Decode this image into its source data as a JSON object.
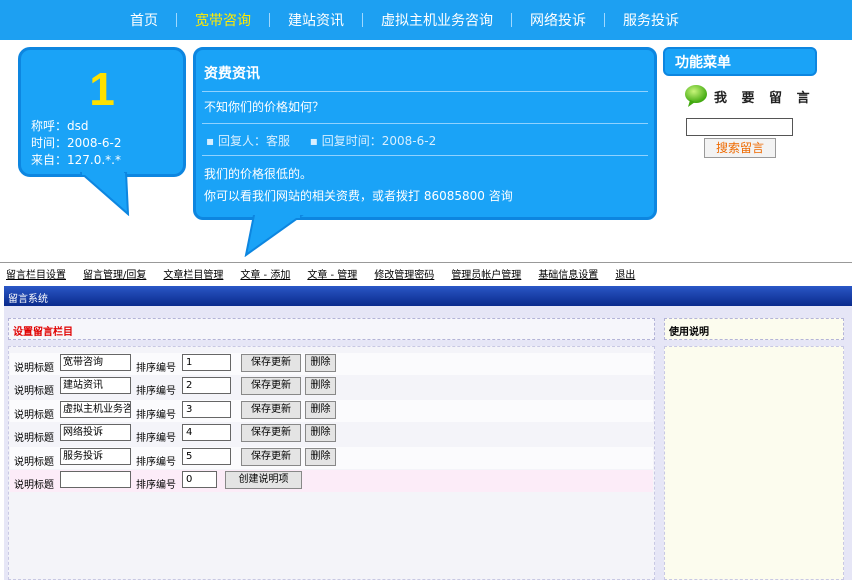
{
  "nav": {
    "items": [
      {
        "label": "首页",
        "active": false
      },
      {
        "label": "宽带咨询",
        "active": true
      },
      {
        "label": "建站资讯",
        "active": false
      },
      {
        "label": "虚拟主机业务咨询",
        "active": false
      },
      {
        "label": "网络投诉",
        "active": false
      },
      {
        "label": "服务投诉",
        "active": false
      }
    ]
  },
  "bubble1": {
    "number": "1",
    "name_line": "称呼：dsd",
    "time_line": "时间：2008-6-2",
    "from_line": "来自：127.0.*.*"
  },
  "bubble2": {
    "title": "资费资讯",
    "question": "不知你们的价格如何？",
    "replier": "▪ 回复人：客服",
    "reply_time": "▪ 回复时间：2008-6-2",
    "answer1": "我们的价格很低的。",
    "answer2": "你可以看我们网站的相关资费，或者拨打 86085800 咨询"
  },
  "func_menu": {
    "title": "功能菜单",
    "message_title": "我 要 留 言",
    "search_value": "",
    "search_button": "搜索留言"
  },
  "admin_nav": {
    "items": [
      "留言栏目设置",
      "留言管理/回复",
      "文章栏目管理",
      "文章 - 添加",
      "文章 - 管理",
      "修改管理密码",
      "管理员帐户管理",
      "基础信息设置",
      "退出"
    ]
  },
  "system_title": "留言系统",
  "panel": {
    "left_title": "设置留言栏目",
    "right_title": "使用说明",
    "label_title": "说明标题",
    "label_order": "排序编号",
    "save_label": "保存更新",
    "delete_label": "删除",
    "create_label": "创建说明项",
    "rows": [
      {
        "title": "宽带咨询",
        "order": "1"
      },
      {
        "title": "建站资讯",
        "order": "2"
      },
      {
        "title": "虚拟主机业务咨询",
        "order": "3"
      },
      {
        "title": "网络投诉",
        "order": "4"
      },
      {
        "title": "服务投诉",
        "order": "5"
      }
    ],
    "new_row": {
      "title": "",
      "order": "0"
    }
  },
  "colors": {
    "nav_bg": "#1da0f2",
    "bubble_bg": "#1aa3f7",
    "active_nav": "#ffea00",
    "number": "#ffe100",
    "panel_title_red": "#e00000",
    "search_button_text": "#ee6a00"
  },
  "icons": {
    "message_icon": "speech-bubble-icon"
  }
}
